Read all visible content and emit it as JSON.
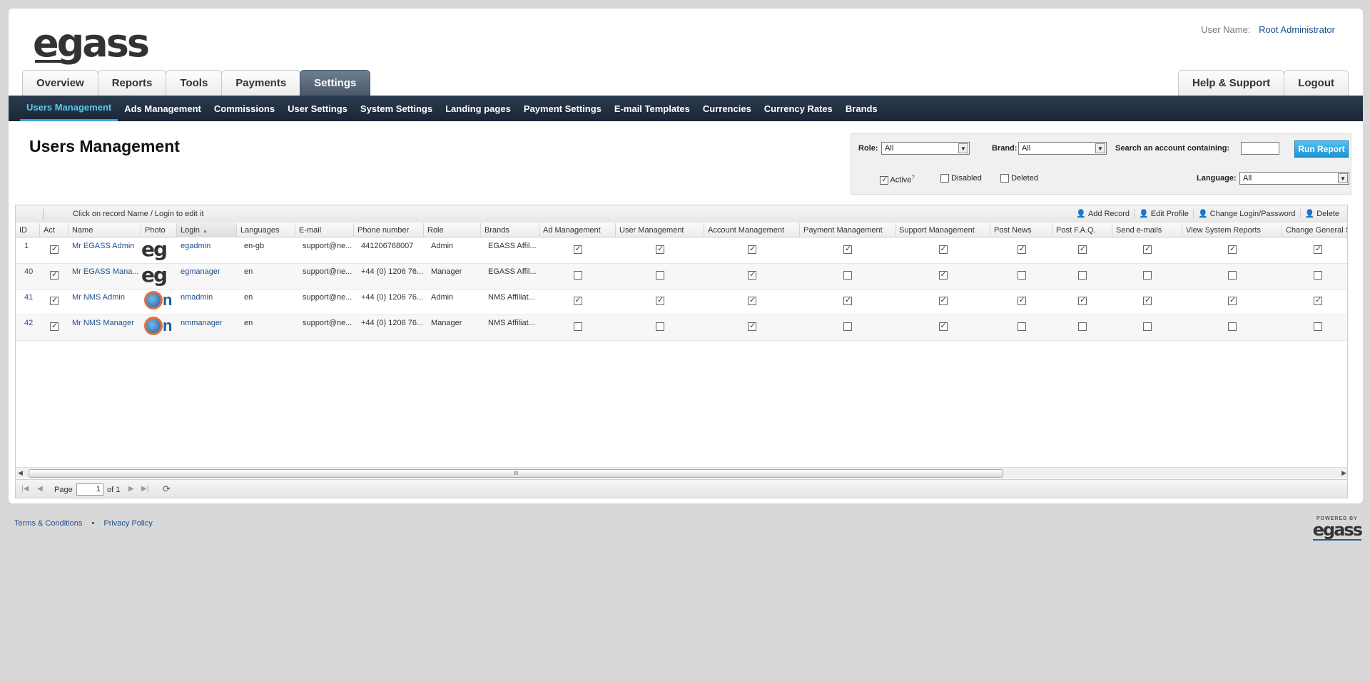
{
  "brand": {
    "logo_text": "egass",
    "powered_by": "POWERED BY",
    "powered_logo": "egass"
  },
  "user": {
    "label": "User Name:",
    "name": "Root Administrator"
  },
  "tabs": [
    {
      "label": "Overview"
    },
    {
      "label": "Reports"
    },
    {
      "label": "Tools"
    },
    {
      "label": "Payments"
    },
    {
      "label": "Settings"
    }
  ],
  "right_tabs": [
    {
      "label": "Help & Support"
    },
    {
      "label": "Logout"
    }
  ],
  "subnav": [
    {
      "label": "Users Management"
    },
    {
      "label": "Ads Management"
    },
    {
      "label": "Commissions"
    },
    {
      "label": "User Settings"
    },
    {
      "label": "System Settings"
    },
    {
      "label": "Landing pages"
    },
    {
      "label": "Payment Settings"
    },
    {
      "label": "E-mail Templates"
    },
    {
      "label": "Currencies"
    },
    {
      "label": "Currency Rates"
    },
    {
      "label": "Brands"
    }
  ],
  "page": {
    "title": "Users Management"
  },
  "filters": {
    "role_label": "Role:",
    "role_value": "All",
    "brand_label": "Brand:",
    "brand_value": "All",
    "search_label": "Search an account containing:",
    "search_value": "",
    "run_label": "Run Report",
    "language_label": "Language:",
    "language_value": "All",
    "active_label": "Active",
    "active_sup": "?",
    "disabled_label": "Disabled",
    "deleted_label": "Deleted"
  },
  "grid": {
    "hint": "Click on record Name / Login to edit it",
    "actions": {
      "add": "Add Record",
      "edit": "Edit Profile",
      "change": "Change Login/Password",
      "delete": "Delete"
    },
    "columns": [
      "ID",
      "Act",
      "Name",
      "Photo",
      "Login",
      "Languages",
      "E-mail",
      "Phone number",
      "Role",
      "Brands",
      "Ad Management",
      "User Management",
      "Account Management",
      "Payment Management",
      "Support Management",
      "Post News",
      "Post F.A.Q.",
      "Send e-mails",
      "View System Reports",
      "Change General Sett"
    ],
    "sort_arrow": "▲",
    "rows": [
      {
        "id": "1",
        "name": "Mr EGASS Admin",
        "photo": "eg",
        "login": "egadmin",
        "lang": "en-gb",
        "email": "support@ne...",
        "phone": "441206768007",
        "role": "Admin",
        "brands": "EGASS Affil..."
      },
      {
        "id": "40",
        "name": "Mr EGASS Mana...",
        "photo": "eg",
        "login": "egmanager",
        "lang": "en",
        "email": "support@ne...",
        "phone": "+44 (0) 1206 76...",
        "role": "Manager",
        "brands": "EGASS Affil..."
      },
      {
        "id": "41",
        "name": "Mr NMS Admin",
        "photo": "n",
        "login": "nmadmin",
        "lang": "en",
        "email": "support@ne...",
        "phone": "+44 (0) 1206 76...",
        "role": "Admin",
        "brands": "NMS Affiliat..."
      },
      {
        "id": "42",
        "name": "Mr NMS Manager",
        "photo": "n",
        "login": "nmmanager",
        "lang": "en",
        "email": "support@ne...",
        "phone": "+44 (0) 1206 76...",
        "role": "Manager",
        "brands": "NMS Affiliat..."
      }
    ],
    "scroll_grip": "III",
    "pager": {
      "page_label": "Page",
      "page_value": "1",
      "of_label": "of 1"
    }
  },
  "footer": {
    "terms": "Terms & Conditions",
    "bullet": "•",
    "privacy": "Privacy Policy"
  },
  "colors": {
    "nav_bg": "#1a2635",
    "accent": "#3aa6d8",
    "link": "#1f4e8c",
    "run_button": "#1d93d2"
  }
}
